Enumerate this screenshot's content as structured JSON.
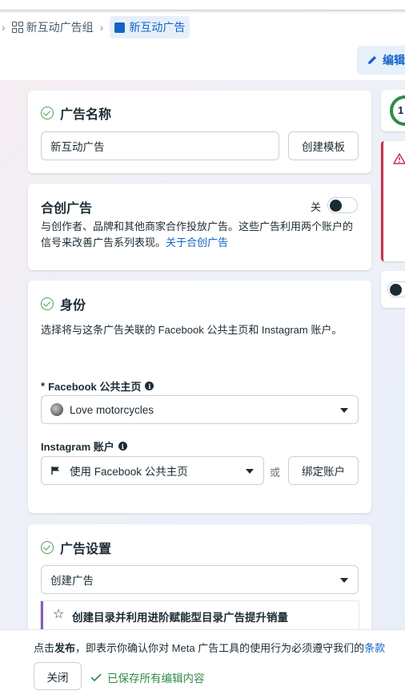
{
  "breadcrumb": {
    "group_label": "新互动广告组",
    "ad_label": "新互动广告"
  },
  "toolbar": {
    "edit_label": "编辑"
  },
  "ad_name_card": {
    "title": "广告名称",
    "name_value": "新互动广告",
    "create_template_label": "创建模板"
  },
  "partnership_card": {
    "title": "合创广告",
    "toggle_state": "关",
    "description": "与创作者、品牌和其他商家合作投放广告。这些广告利用两个账户的信号来改善广告系列表现。",
    "link_text": "关于合创广告"
  },
  "identity_card": {
    "title": "身份",
    "description": "选择将与这条广告关联的 Facebook 公共主页和 Instagram 账户。",
    "facebook_required_mark": "*",
    "facebook_label": "Facebook 公共主页",
    "facebook_value": "Love motorcycles",
    "instagram_label": "Instagram 账户",
    "instagram_value": "使用 Facebook 公共主页",
    "or_text": "或",
    "bind_account_label": "绑定账户"
  },
  "ad_setup_card": {
    "title": "广告设置",
    "create_ad_value": "创建广告",
    "promo_text": "创建目录并利用进阶赋能型目录广告提升销量"
  },
  "right_panel": {
    "score_text": "1"
  },
  "footer": {
    "notice_prefix": "点击",
    "notice_bold": "发布",
    "notice_rest": "，即表示你确认你对 Meta 广告工具的使用行为必须遵守我们的",
    "notice_link": "条款",
    "close_label": "关闭",
    "saved_status": "已保存所有编辑内容"
  },
  "colors": {
    "accent_blue": "#1464c8",
    "success_green": "#4aa05a",
    "error_red": "#c8314b",
    "promo_purple": "#8a5bb8"
  }
}
